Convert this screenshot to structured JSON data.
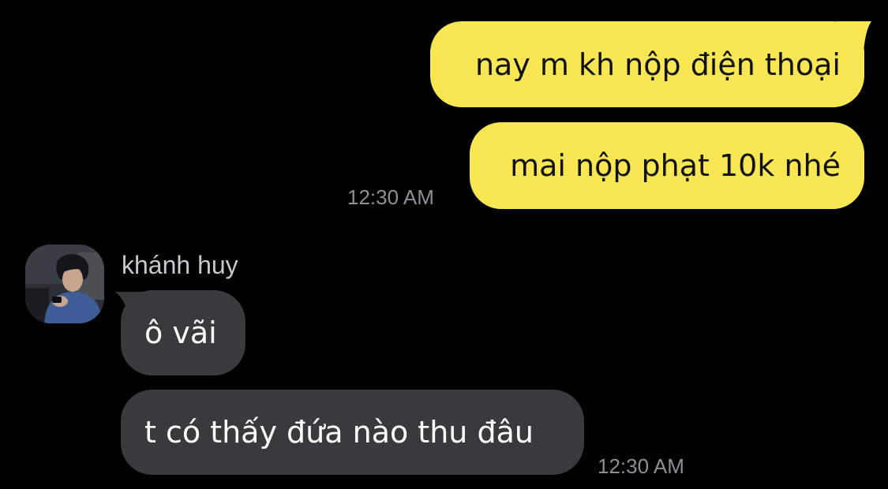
{
  "colors": {
    "background": "#000000",
    "outgoing_bubble": "#f8e653",
    "incoming_bubble": "#3a3a3c",
    "timestamp": "#8e8e93"
  },
  "outgoing": {
    "messages": [
      "nay m kh nộp điện thoại",
      "mai nộp phạt 10k nhé"
    ],
    "time": "12:30 AM"
  },
  "incoming": {
    "sender": "khánh huy",
    "avatar_icon": "profile-photo-icon",
    "messages": [
      "ô vãi",
      "t có thấy đứa nào thu đâu"
    ],
    "time": "12:30 AM"
  }
}
